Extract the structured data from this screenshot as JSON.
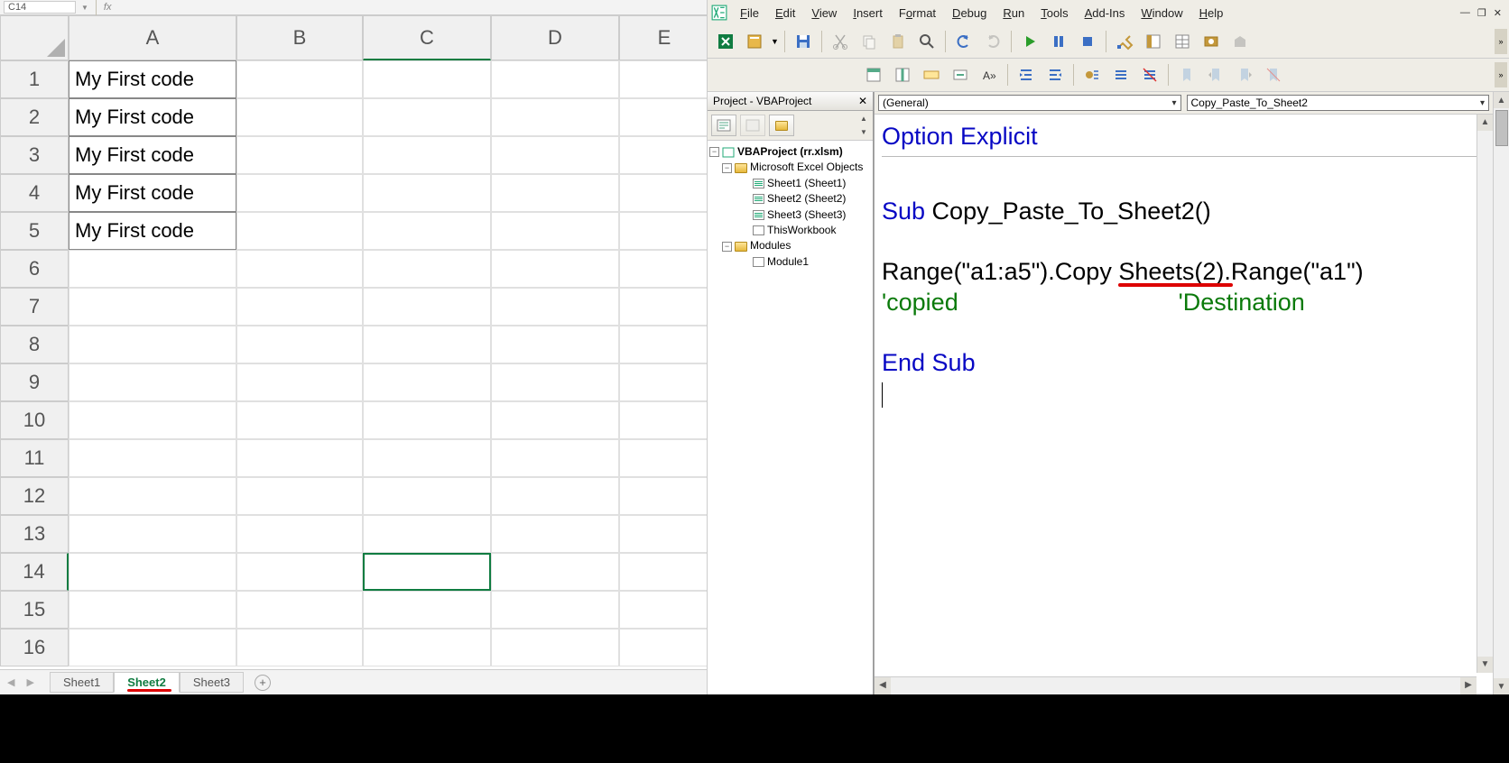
{
  "excel": {
    "namebox": "C14",
    "fx": "fx",
    "columns": [
      "A",
      "B",
      "C",
      "D",
      "E"
    ],
    "rows": [
      "1",
      "2",
      "3",
      "4",
      "5",
      "6",
      "7",
      "8",
      "9",
      "10",
      "11",
      "12",
      "13",
      "14",
      "15",
      "16"
    ],
    "cellA": [
      "My First code",
      "My First code",
      "My First code",
      "My First code",
      "My First code"
    ],
    "activeCol": "C",
    "activeRow": "14",
    "tabs": {
      "sheet1": "Sheet1",
      "sheet2": "Sheet2",
      "sheet3": "Sheet3"
    }
  },
  "vba": {
    "menus": [
      "File",
      "Edit",
      "View",
      "Insert",
      "Format",
      "Debug",
      "Run",
      "Tools",
      "Add-Ins",
      "Window",
      "Help"
    ],
    "projectTitle": "Project - VBAProject",
    "tree": {
      "root": "VBAProject (rr.xlsm)",
      "excelObjects": "Microsoft Excel Objects",
      "sheet1": "Sheet1 (Sheet1)",
      "sheet2": "Sheet2 (Sheet2)",
      "sheet3": "Sheet3 (Sheet3)",
      "thiswb": "ThisWorkbook",
      "modules": "Modules",
      "module1": "Module1"
    },
    "ddLeft": "(General)",
    "ddRight": "Copy_Paste_To_Sheet2",
    "code": {
      "l1a": "Option Explicit",
      "l2a": "Sub",
      "l2b": " Copy_Paste_To_Sheet2()",
      "l3a": "Range(\"a1:a5\").Copy ",
      "l3b": "Sheets(2)",
      "l3c": ".Range(\"a1\")",
      "l4a": "'copied",
      "l4b": "'Destination",
      "l5a": "End Sub"
    }
  }
}
